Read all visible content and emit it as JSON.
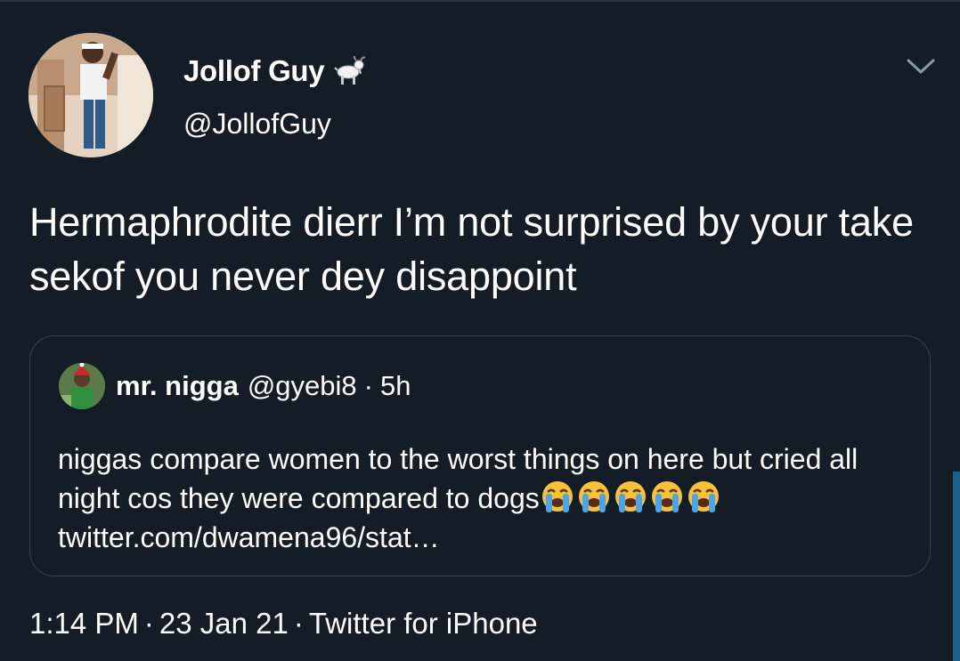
{
  "tweet": {
    "author": {
      "display_name": "Jollof Guy",
      "handle": "@JollofGuy",
      "name_emoji": "goat-icon"
    },
    "text": "Hermaphrodite dierr I’m not surprised by your take sekof you never dey disappoint",
    "quoted": {
      "name": "mr. nigga",
      "handle": "@gyebi8",
      "separator": "·",
      "time": "5h",
      "text": "niggas compare women to the worst things on here but cried all night cos they were compared to dogs",
      "emojis": [
        "loudly-crying-face-icon",
        "loudly-crying-face-icon",
        "loudly-crying-face-icon",
        "loudly-crying-face-icon",
        "loudly-crying-face-icon"
      ],
      "link": "twitter.com/dwamena96/stat…"
    },
    "meta": {
      "time": "1:14 PM",
      "date": "23 Jan 21",
      "source": "Twitter for iPhone",
      "separator": "·"
    }
  },
  "colors": {
    "background": "#141d26",
    "border": "#38444d",
    "text": "#ffffff"
  }
}
